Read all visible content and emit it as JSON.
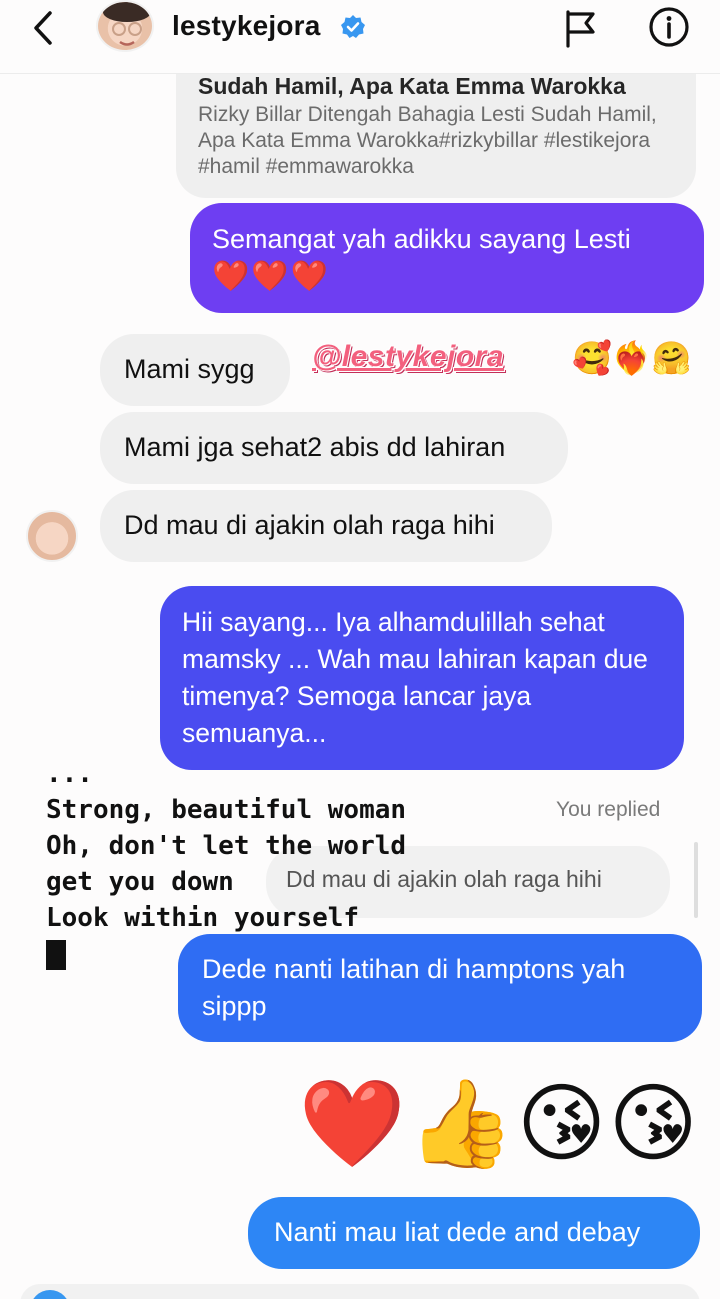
{
  "header": {
    "username": "lestykejora",
    "verified": true
  },
  "shared_post": {
    "title": "Sudah Hamil, Apa Kata Emma Warokka",
    "description": "Rizky Billar Ditengah Bahagia Lesti Sudah Hamil, Apa Kata Emma Warokka#rizkybillar #lestikejora #hamil #emmawarokka"
  },
  "messages": {
    "sent_1": "Semangat yah adikku sayang Lesti",
    "sent_1_emojis": "❤️❤️❤️",
    "received_1": "Mami sygg",
    "received_2": "Mami jga sehat2 abis dd lahiran",
    "received_3": "Dd mau di ajakin olah raga hihi",
    "sent_2": "Hii sayang... Iya alhamdulillah sehat mamsky ... Wah mau lahiran kapan due timenya? Semoga lancar jaya semuanya...",
    "you_replied": "You replied",
    "reply_quote": "Dd mau di ajakin olah raga hihi",
    "sent_3": "Dede nanti latihan di hamptons yah sippp",
    "emoji_message": "❤️👍😘😘",
    "sent_4": "Nanti mau liat dede and debay"
  },
  "overlay": {
    "mention": "@lestykejora",
    "mention_emojis": "🥰❤️‍🔥🤗",
    "lyrics_ellipsis": "...",
    "lyrics_line_1": "Strong, beautiful woman",
    "lyrics_line_2": "Oh, don't let the world",
    "lyrics_line_3": "get you down",
    "lyrics_line_4": "Look within yourself"
  },
  "colors": {
    "sent_purple": "#6e3ef2",
    "sent_indigo": "#4a4cf0",
    "sent_blue": "#2f6df3",
    "sent_light_blue": "#2d86f5",
    "received_grey": "#efefef",
    "verified_blue": "#3897f0",
    "mention_pink": "#f3607e"
  },
  "icons": {
    "back": "chevron-left-icon",
    "verified": "verified-badge-icon",
    "flag": "flag-icon",
    "info": "info-icon"
  }
}
